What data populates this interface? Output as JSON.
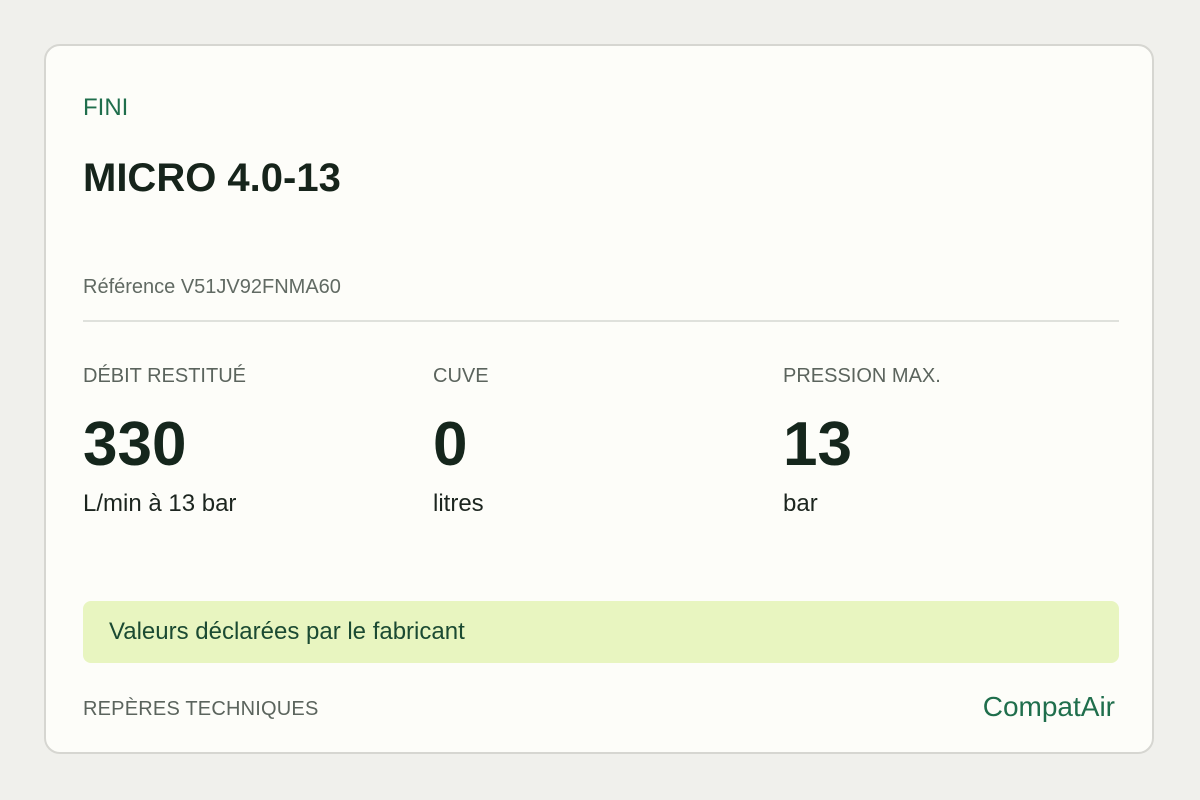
{
  "card": {
    "status": "FINI",
    "title": "MICRO 4.0-13",
    "reference": "Référence V51JV92FNMA60",
    "stats": [
      {
        "label": "DÉBIT RESTITUÉ",
        "value": "330",
        "unit": "L/min à 13 bar"
      },
      {
        "label": "CUVE",
        "value": "0",
        "unit": "litres"
      },
      {
        "label": "PRESSION MAX.",
        "value": "13",
        "unit": "bar"
      }
    ],
    "notice": "Valeurs déclarées par le fabricant",
    "footer_label": "REPÈRES TECHNIQUES",
    "brand": "CompatAir"
  },
  "colors": {
    "page_background": "#f0f0ec",
    "card_background": "#fdfdf9",
    "accent_green": "#1f6e4c",
    "notice_background": "#e8f5c0",
    "heading_text": "#16241b",
    "muted_text": "#5b645d"
  }
}
